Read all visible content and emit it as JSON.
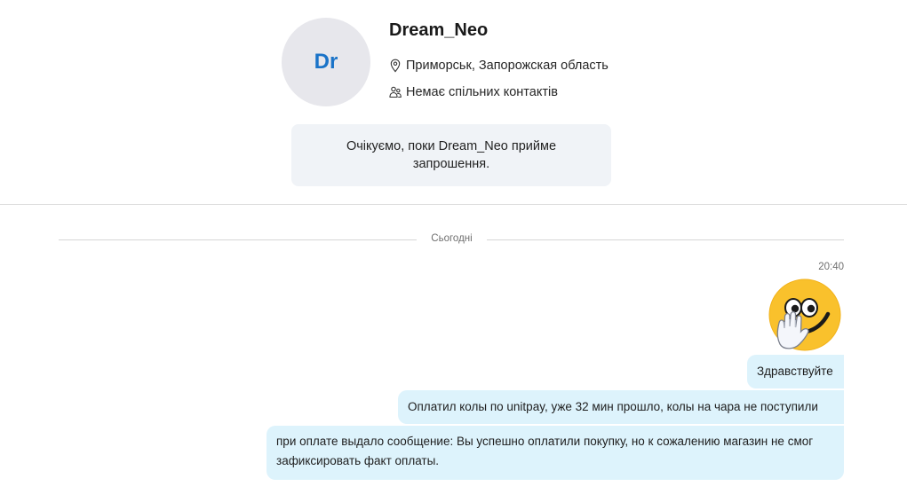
{
  "profile": {
    "avatar_initials": "Dr",
    "name": "Dream_Neo",
    "location": "Приморськ, Запорожская область",
    "contacts": "Немає спільних контактів",
    "location_icon": "location-pin-icon",
    "contacts_icon": "people-icon"
  },
  "invite": {
    "text": "Очікуємо, поки Dream_Neo прийме запрошення."
  },
  "conversation": {
    "date_label": "Сьогодні",
    "timestamp": "20:40",
    "emoji": "wave-emoji",
    "messages": [
      {
        "text": "Здравствуйте"
      },
      {
        "text": "Оплатил колы по unitpay, уже 32 мин прошло, колы на чара не поступили"
      },
      {
        "text": "при оплате выдало сообщение: Вы успешно оплатили покупку, но к сожалению магазин не смог зафиксировать факт оплаты."
      }
    ]
  },
  "colors": {
    "accent": "#1a73c8",
    "bubble": "#ddf3fc",
    "invite_bg": "#f0f3f7",
    "avatar_bg": "#e7e7ec"
  }
}
